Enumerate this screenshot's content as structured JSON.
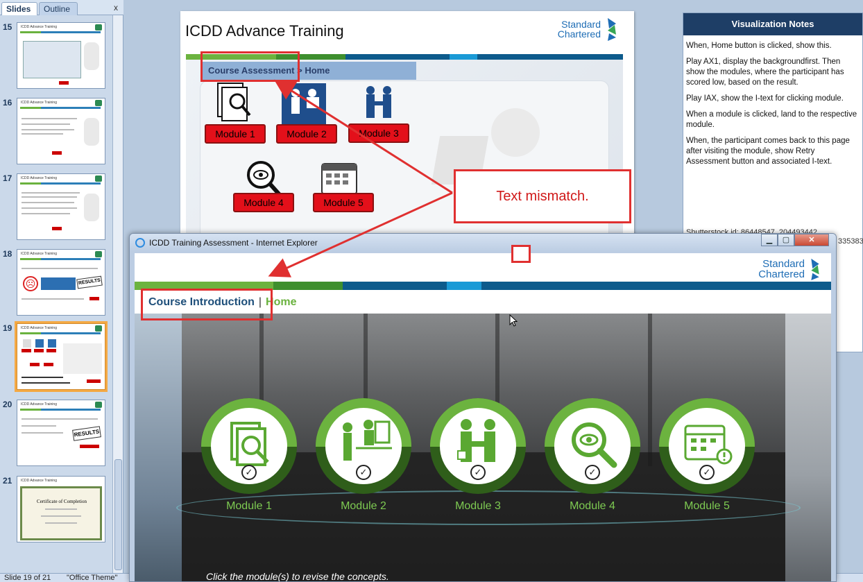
{
  "slides_pane": {
    "tab_slides": "Slides",
    "tab_outline": "Outline",
    "close": "x",
    "thumbs": [
      {
        "num": "15",
        "title": "ICDD Advance Training"
      },
      {
        "num": "16",
        "title": "ICDD Advance Training"
      },
      {
        "num": "17",
        "title": "ICDD Advance Training"
      },
      {
        "num": "18",
        "title": "ICDD Advance Training",
        "badge": "RESULTS"
      },
      {
        "num": "19",
        "title": "ICDD Advance Training"
      },
      {
        "num": "20",
        "title": "ICDD Advance Training",
        "badge": "RESULTS"
      },
      {
        "num": "21",
        "title": "ICDD Advance Training",
        "heading": "Certificate of Completion"
      }
    ],
    "selected": "19"
  },
  "status": {
    "slide": "Slide 19 of 21",
    "theme": "\"Office Theme\""
  },
  "slide": {
    "title": "ICDD Advance Training",
    "logo_line1": "Standard",
    "logo_line2": "Chartered",
    "breadcrumb": "Course Assessment > Home",
    "modules": [
      "Module 1",
      "Module 2",
      "Module 3",
      "Module 4",
      "Module 5"
    ]
  },
  "notes": {
    "header": "Visualization Notes",
    "p1": "When, Home button is clicked, show this.",
    "p2": "Play AX1, display the backgroundfirst. Then show the modules, where the participant has scored low, based on the result.",
    "p3": "Play IAX, show the I-text for clicking module.",
    "p4": "When a module is clicked, land to the respective module.",
    "p5": "When, the participant comes back to this page after visiting the module, show Retry Assessment button and associated I-text.",
    "faded": "Shutterstock id: 86448547, 204493442",
    "faded_right": "335383"
  },
  "callout": {
    "text": "Text mismatch."
  },
  "ie": {
    "title": "ICDD Training Assessment - Internet Explorer",
    "logo_line1": "Standard",
    "logo_line2": "Chartered",
    "breadcrumb_a": "Course Introduction",
    "breadcrumb_sep": "|",
    "breadcrumb_b": "Home",
    "modules": [
      "Module 1",
      "Module 2",
      "Module 3",
      "Module 4",
      "Module 5"
    ],
    "hint": "Click the module(s) to revise the concepts."
  },
  "colors": {
    "accent_green": "#6cb33f",
    "brand_blue": "#1e6db5",
    "annotation_red": "#e03030",
    "module_red": "#e3101a"
  }
}
